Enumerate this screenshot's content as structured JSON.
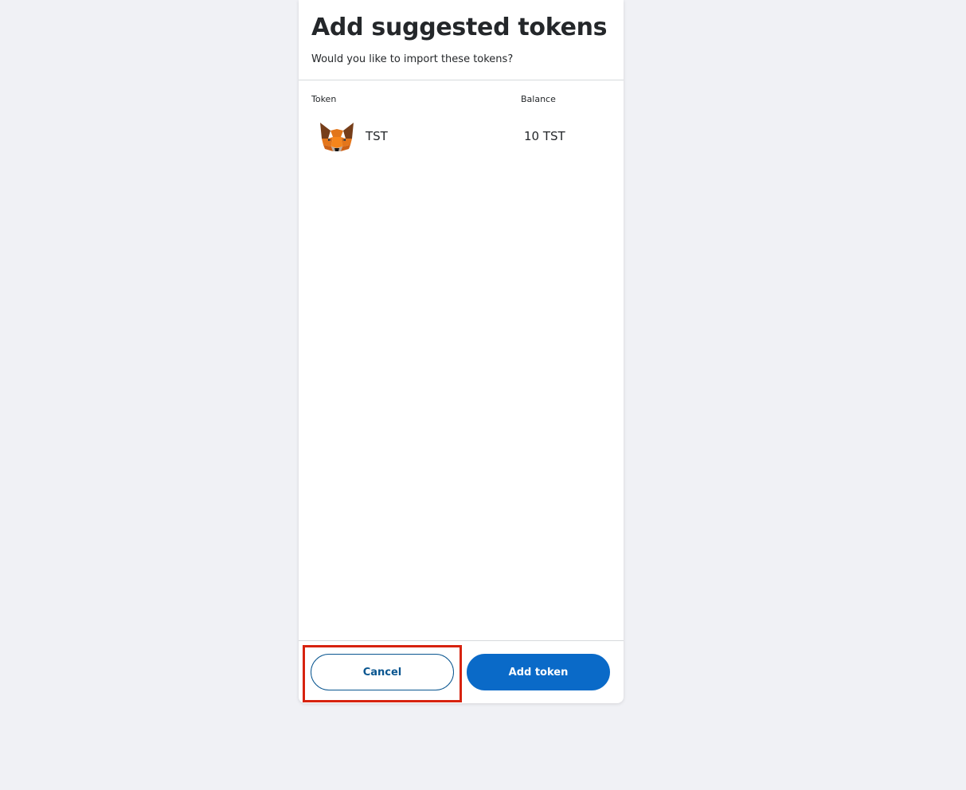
{
  "dialog": {
    "title": "Add suggested tokens",
    "subtitle": "Would you like to import these tokens?"
  },
  "table": {
    "headers": {
      "token": "Token",
      "balance": "Balance"
    },
    "rows": [
      {
        "icon": "metamask-fox-icon",
        "symbol": "TST",
        "balance": "10 TST"
      }
    ]
  },
  "footer": {
    "cancel_label": "Cancel",
    "add_label": "Add token"
  },
  "colors": {
    "primary": "#0a6ac8",
    "secondary_border": "#0a5690",
    "highlight": "#d7230f",
    "background": "#f0f1f5"
  }
}
